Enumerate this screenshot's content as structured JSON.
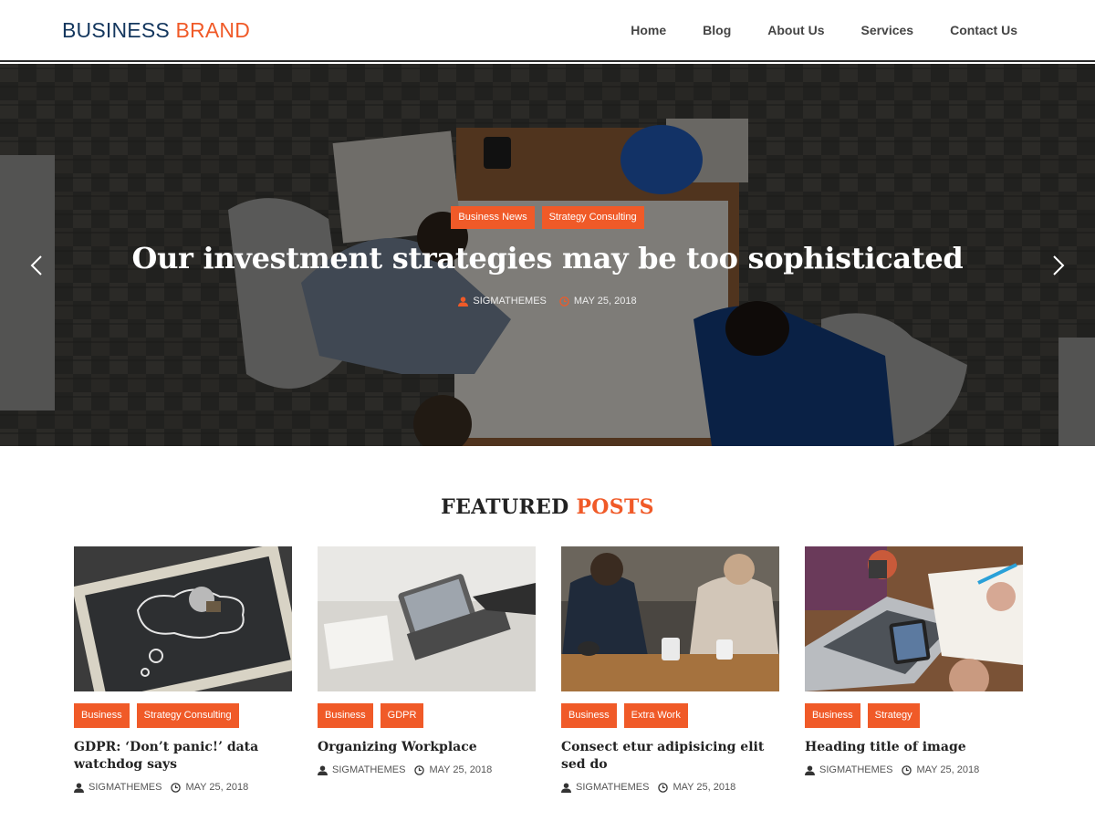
{
  "brand": {
    "part1": "BUSINESS",
    "part2": "BRAND"
  },
  "nav": [
    "Home",
    "Blog",
    "About Us",
    "Services",
    "Contact Us"
  ],
  "hero": {
    "categories": [
      "Business News",
      "Strategy Consulting"
    ],
    "title": "Our investment strategies may be too sophisticated",
    "author": "SIGMATHEMES",
    "date": "MAY 25, 2018"
  },
  "featured": {
    "title_part1": "FEATURED",
    "title_part2": "POSTS"
  },
  "posts": [
    {
      "categories": [
        "Business",
        "Strategy Consulting"
      ],
      "title": "GDPR: ‘Don’t panic!’ data watchdog says",
      "author": "SIGMATHEMES",
      "date": "MAY 25, 2018"
    },
    {
      "categories": [
        "Business",
        "GDPR"
      ],
      "title": "Organizing Workplace",
      "author": "SIGMATHEMES",
      "date": "MAY 25, 2018"
    },
    {
      "categories": [
        "Business",
        "Extra Work"
      ],
      "title": "Consect etur adipisicing elit sed do",
      "author": "SIGMATHEMES",
      "date": "MAY 25, 2018"
    },
    {
      "categories": [
        "Business",
        "Strategy"
      ],
      "title": "Heading title of image",
      "author": "SIGMATHEMES",
      "date": "MAY 25, 2018"
    }
  ],
  "colors": {
    "accent": "#f05a28",
    "brand_dark": "#14375e"
  },
  "icons": {
    "author": "user-icon",
    "date": "clock-icon",
    "prev": "chevron-left-icon",
    "next": "chevron-right-icon"
  }
}
